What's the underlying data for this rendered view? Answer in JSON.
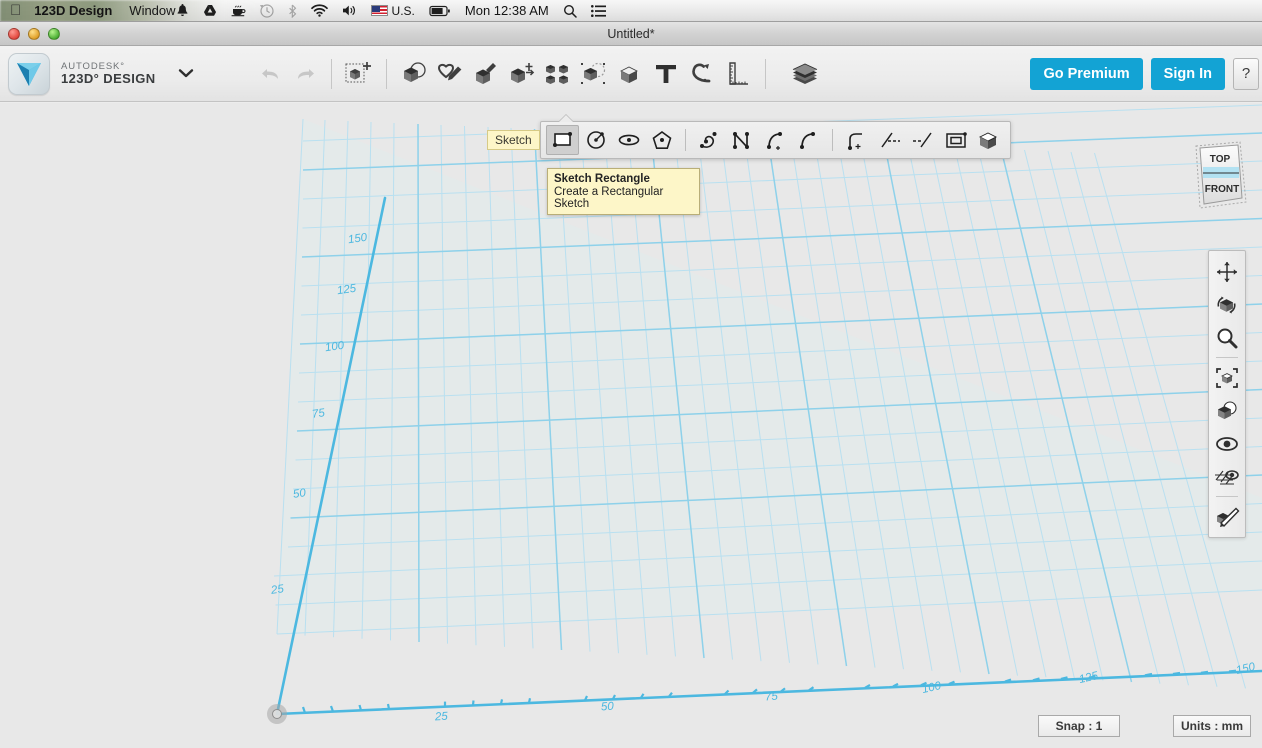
{
  "menubar": {
    "apple": "apple-logo",
    "app_name": "123D Design",
    "items": [
      "Window"
    ],
    "language": "U.S.",
    "clock": "Mon 12:38 AM",
    "icons": [
      "notification-bell-icon",
      "google-drive-icon",
      "caffeine-cup-icon",
      "time-machine-icon",
      "bluetooth-icon",
      "wifi-icon",
      "volume-icon",
      "flag-icon",
      "battery-icon",
      "spotlight-search-icon",
      "notification-center-icon"
    ]
  },
  "window": {
    "title": "Untitled*",
    "controls": [
      "close-button",
      "minimize-button",
      "zoom-button"
    ]
  },
  "toolbar": {
    "brand_top": "AUTODESK°",
    "brand_bottom": "123D° DESIGN",
    "dropdown": "application-menu-chevron",
    "undo": "undo-arrow",
    "redo": "redo-arrow",
    "tools": [
      {
        "name": "transform-tool",
        "label": "Transform"
      },
      {
        "name": "primitives-tool",
        "label": "Primitives"
      },
      {
        "name": "sketch-tool",
        "label": "Sketch"
      },
      {
        "name": "construct-tool",
        "label": "Construct"
      },
      {
        "name": "modify-tool",
        "label": "Modify"
      },
      {
        "name": "pattern-tool",
        "label": "Pattern"
      },
      {
        "name": "grouping-tool",
        "label": "Grouping"
      },
      {
        "name": "combine-tool",
        "label": "Combine"
      },
      {
        "name": "text-tool",
        "label": "Text"
      },
      {
        "name": "snap-tool",
        "label": "Snap"
      },
      {
        "name": "measure-tool",
        "label": "Measure"
      },
      {
        "name": "materials-tool",
        "label": "Materials"
      }
    ],
    "go_premium": "Go Premium",
    "sign_in": "Sign In",
    "help": "?"
  },
  "sketch_toolbar": {
    "label": "Sketch",
    "tools": [
      {
        "name": "sketch-rectangle-tool",
        "active": true
      },
      {
        "name": "sketch-circle-tool",
        "active": false
      },
      {
        "name": "sketch-ellipse-tool",
        "active": false
      },
      {
        "name": "sketch-polygon-tool",
        "active": false
      },
      {
        "name": "sketch-spline-tool",
        "active": false
      },
      {
        "name": "sketch-polyline-tool",
        "active": false
      },
      {
        "name": "sketch-two-point-arc-tool",
        "active": false
      },
      {
        "name": "sketch-three-point-arc-tool",
        "active": false
      },
      {
        "name": "sketch-fillet-tool",
        "active": false
      },
      {
        "name": "sketch-trim-tool",
        "active": false
      },
      {
        "name": "sketch-extend-tool",
        "active": false
      },
      {
        "name": "sketch-offset-tool",
        "active": false
      },
      {
        "name": "sketch-project-tool",
        "active": false
      }
    ]
  },
  "tooltip": {
    "title": "Sketch Rectangle",
    "body": "Create a Rectangular Sketch"
  },
  "viewcube": {
    "top_face": "TOP",
    "front_face": "FRONT"
  },
  "palette": {
    "buttons": [
      {
        "name": "pan-tool"
      },
      {
        "name": "orbit-tool"
      },
      {
        "name": "zoom-tool"
      },
      {
        "name": "fit-to-view-tool"
      },
      {
        "name": "display-shading-tool"
      },
      {
        "name": "visibility-eye-tool"
      },
      {
        "name": "grid-snap-tool"
      },
      {
        "name": "material-brush-tool"
      }
    ]
  },
  "canvas": {
    "grid_labels_left": [
      "25",
      "50",
      "75",
      "100",
      "125",
      "150"
    ],
    "grid_labels_bottom": [
      "25",
      "50",
      "75",
      "100",
      "125",
      "150"
    ],
    "origin_marker": "origin-handle",
    "colors": {
      "grid_fill": "#e4eaea",
      "grid_minor": "#bfe2f2",
      "grid_major": "#8ed1ea",
      "axis": "#4cb8e0",
      "background": "#e8e8e8",
      "accent": "#13a3d4"
    }
  },
  "statusbar": {
    "snap": "Snap : 1",
    "units": "Units : mm"
  }
}
